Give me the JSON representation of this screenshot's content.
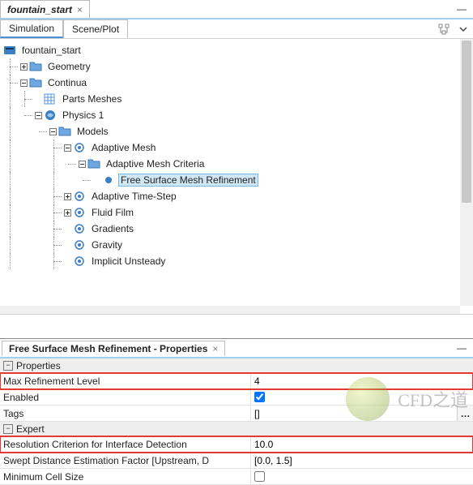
{
  "window": {
    "tab_title": "fountain_start",
    "minimize_glyph": "—"
  },
  "secondary_tabs": {
    "simulation": "Simulation",
    "scene_plot": "Scene/Plot"
  },
  "tree": {
    "root": "fountain_start",
    "geometry": "Geometry",
    "continua": "Continua",
    "parts_meshes": "Parts Meshes",
    "physics1": "Physics 1",
    "models": "Models",
    "adaptive_mesh": "Adaptive Mesh",
    "adaptive_mesh_criteria": "Adaptive Mesh Criteria",
    "free_surface_mesh_refinement": "Free Surface Mesh Refinement",
    "adaptive_time_step": "Adaptive Time-Step",
    "fluid_film": "Fluid Film",
    "gradients": "Gradients",
    "gravity": "Gravity",
    "implicit_unsteady": "Implicit Unsteady"
  },
  "properties": {
    "title": "Free Surface Mesh Refinement - Properties",
    "group_properties": "Properties",
    "group_expert": "Expert",
    "rows": {
      "max_refinement_level": {
        "name": "Max Refinement Level",
        "value": "4"
      },
      "enabled": {
        "name": "Enabled",
        "checked": true
      },
      "tags": {
        "name": "Tags",
        "value": "[]"
      },
      "resolution_criterion": {
        "name": "Resolution Criterion for Interface Detection",
        "value": "10.0"
      },
      "swept_distance": {
        "name": "Swept Distance Estimation Factor [Upstream, D",
        "value": "[0.0, 1.5]"
      },
      "minimum_cell_size": {
        "name": "Minimum Cell Size",
        "checked": false
      }
    }
  },
  "overlay": {
    "text": "CFD之道"
  }
}
